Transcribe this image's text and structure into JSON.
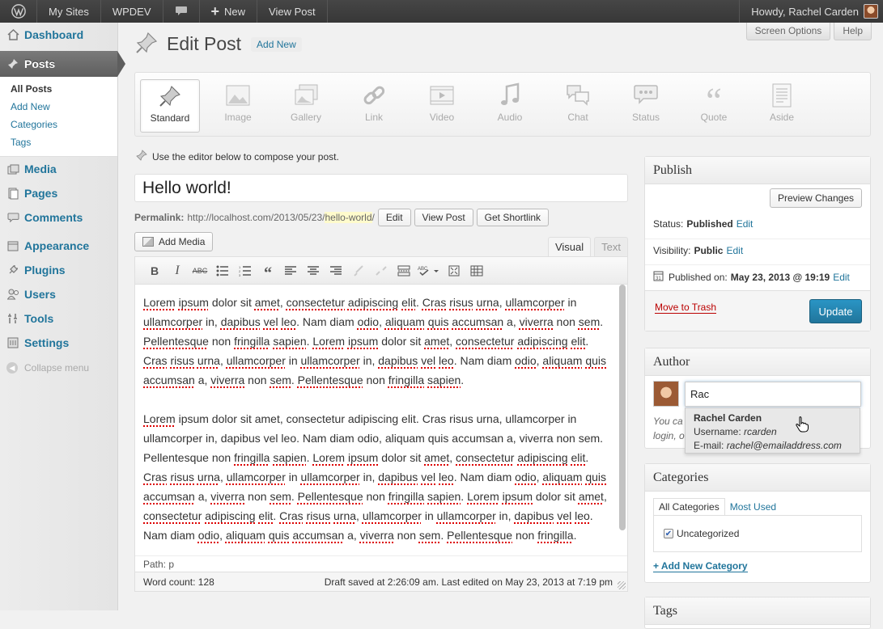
{
  "adminbar": {
    "my_sites": "My Sites",
    "site": "WPDEV",
    "new_label": "New",
    "view_post": "View Post",
    "howdy": "Howdy, Rachel Carden"
  },
  "menu": {
    "dashboard": "Dashboard",
    "posts": "Posts",
    "posts_sub": [
      "All Posts",
      "Add New",
      "Categories",
      "Tags"
    ],
    "media": "Media",
    "pages": "Pages",
    "comments": "Comments",
    "appearance": "Appearance",
    "plugins": "Plugins",
    "users": "Users",
    "tools": "Tools",
    "settings": "Settings",
    "collapse": "Collapse menu"
  },
  "header": {
    "title": "Edit Post",
    "add_new": "Add New",
    "screen_options": "Screen Options",
    "help": "Help"
  },
  "formats": [
    "Standard",
    "Image",
    "Gallery",
    "Link",
    "Video",
    "Audio",
    "Chat",
    "Status",
    "Quote",
    "Aside"
  ],
  "editor": {
    "hint": "Use the editor below to compose your post.",
    "title": "Hello world!",
    "permalink_label": "Permalink:",
    "permalink_base": "http://localhost.com/2013/05/23/",
    "permalink_slug": "hello-world",
    "permalink_end": "/",
    "edit_btn": "Edit",
    "view_post_btn": "View Post",
    "shortlink_btn": "Get Shortlink",
    "add_media": "Add Media",
    "tab_visual": "Visual",
    "tab_text": "Text",
    "path": "Path: p",
    "word_count": "Word count: 128",
    "draft_saved": "Draft saved at 2:26:09 am. Last edited on May 23, 2013 at 7:19 pm"
  },
  "publish": {
    "title": "Publish",
    "preview": "Preview Changes",
    "status_label": "Status:",
    "status_value": "Published",
    "visibility_label": "Visibility:",
    "visibility_value": "Public",
    "published_label": "Published on:",
    "published_value": "May 23, 2013 @ 19:19",
    "edit": "Edit",
    "trash": "Move to Trash",
    "update": "Update"
  },
  "author": {
    "title": "Author",
    "input_value": "Rac",
    "help_l1": "You ca",
    "help_l2": "login, o",
    "suggest_name": "Rachel Carden",
    "suggest_username_label": "Username:",
    "suggest_username": "rcarden",
    "suggest_email_label": "E-mail:",
    "suggest_email": "rachel@emailaddress.com"
  },
  "categories": {
    "title": "Categories",
    "tab_all": "All Categories",
    "tab_most": "Most Used",
    "item": "Uncategorized",
    "add_new": "+ Add New Category"
  },
  "tags": {
    "title": "Tags"
  }
}
